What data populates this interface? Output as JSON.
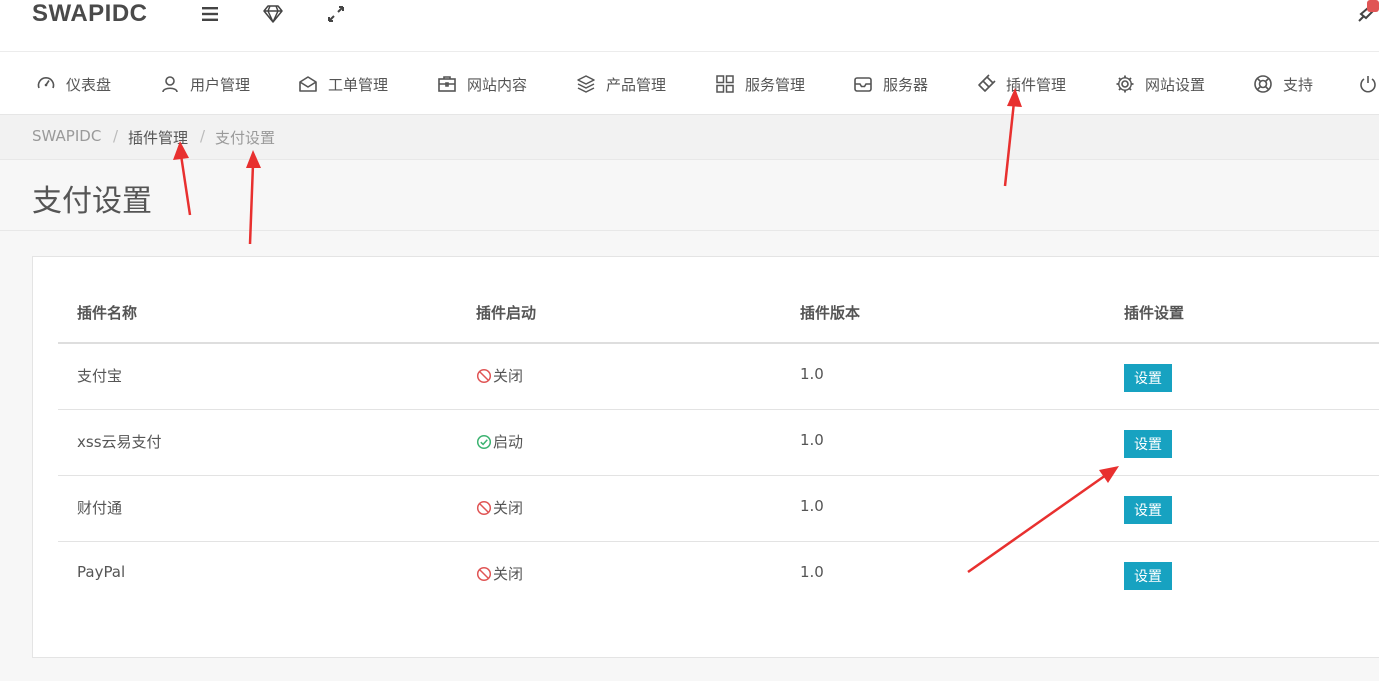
{
  "topbar": {
    "brand": "SWAPIDC",
    "icons": [
      "menu-icon",
      "diamond-icon",
      "expand-icon"
    ]
  },
  "nav": {
    "items": [
      {
        "label": "仪表盘",
        "icon": "dashboard-icon"
      },
      {
        "label": "用户管理",
        "icon": "user-icon"
      },
      {
        "label": "工单管理",
        "icon": "envelope-icon"
      },
      {
        "label": "网站内容",
        "icon": "briefcase-icon"
      },
      {
        "label": "产品管理",
        "icon": "layers-icon"
      },
      {
        "label": "服务管理",
        "icon": "grid-icon"
      },
      {
        "label": "服务器",
        "icon": "inbox-icon"
      },
      {
        "label": "插件管理",
        "icon": "plugin-icon"
      },
      {
        "label": "网站设置",
        "icon": "gear-icon"
      },
      {
        "label": "支持",
        "icon": "lifebuoy-icon"
      }
    ],
    "trailing_icon": "power-icon"
  },
  "breadcrumb": {
    "root": "SWAPIDC",
    "section": "插件管理",
    "current": "支付设置",
    "separator": "/"
  },
  "page": {
    "title": "支付设置"
  },
  "table": {
    "headers": [
      "插件名称",
      "插件启动",
      "插件版本",
      "插件设置"
    ],
    "rows": [
      {
        "name": "支付宝",
        "status": "关闭",
        "enabled": false,
        "version": "1.0",
        "action": "设置"
      },
      {
        "name": "xss云易支付",
        "status": "启动",
        "enabled": true,
        "version": "1.0",
        "action": "设置"
      },
      {
        "name": "财付通",
        "status": "关闭",
        "enabled": false,
        "version": "1.0",
        "action": "设置"
      },
      {
        "name": "PayPal",
        "status": "关闭",
        "enabled": false,
        "version": "1.0",
        "action": "设置"
      }
    ]
  },
  "colors": {
    "accent": "#17a2c1",
    "off_status": "#e05555",
    "on_status": "#3cb371",
    "annotation": "#e8302f"
  }
}
